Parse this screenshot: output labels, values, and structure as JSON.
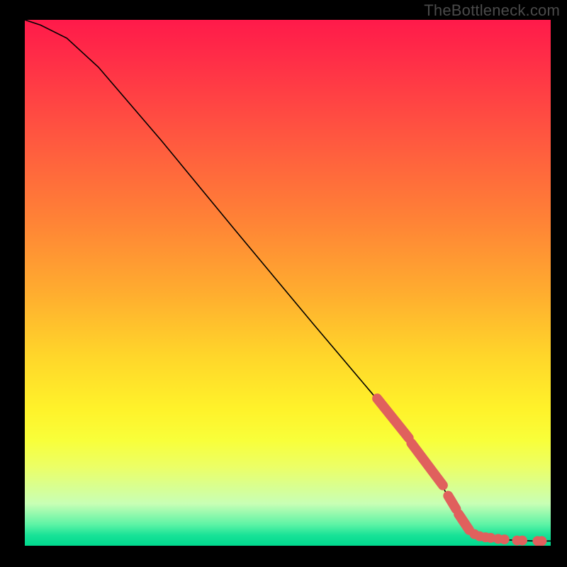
{
  "attribution": "TheBottleneck.com",
  "chart_data": {
    "type": "line",
    "title": "",
    "xlabel": "",
    "ylabel": "",
    "xlim": [
      0,
      100
    ],
    "ylim": [
      0,
      100
    ],
    "curve": [
      {
        "x": 0,
        "y": 100
      },
      {
        "x": 3,
        "y": 99
      },
      {
        "x": 8,
        "y": 96.5
      },
      {
        "x": 14,
        "y": 91
      },
      {
        "x": 26,
        "y": 77
      },
      {
        "x": 40,
        "y": 60
      },
      {
        "x": 55,
        "y": 42
      },
      {
        "x": 66,
        "y": 29
      },
      {
        "x": 74,
        "y": 19
      },
      {
        "x": 79,
        "y": 12
      },
      {
        "x": 83,
        "y": 5
      },
      {
        "x": 85,
        "y": 2.5
      },
      {
        "x": 87,
        "y": 1.5
      },
      {
        "x": 90,
        "y": 1.2
      },
      {
        "x": 94,
        "y": 1.0
      },
      {
        "x": 97,
        "y": 0.9
      },
      {
        "x": 100,
        "y": 0.9
      }
    ],
    "highlight_segments": [
      {
        "x1": 67,
        "y1": 28,
        "x2": 73,
        "y2": 20.5
      },
      {
        "x1": 73.5,
        "y1": 19.5,
        "x2": 79.5,
        "y2": 11.5
      },
      {
        "x1": 80.5,
        "y1": 9.5,
        "x2": 82,
        "y2": 7
      },
      {
        "x1": 82.5,
        "y1": 6,
        "x2": 84.5,
        "y2": 3
      }
    ],
    "highlight_points": [
      {
        "x": 85.5,
        "y": 2.2
      },
      {
        "x": 86.5,
        "y": 1.8
      },
      {
        "x": 87.6,
        "y": 1.6
      },
      {
        "x": 88.6,
        "y": 1.5
      },
      {
        "x": 90.0,
        "y": 1.3
      },
      {
        "x": 91.2,
        "y": 1.2
      },
      {
        "x": 93.6,
        "y": 1.0
      },
      {
        "x": 94.6,
        "y": 1.0
      },
      {
        "x": 97.5,
        "y": 0.9
      },
      {
        "x": 98.3,
        "y": 0.9
      }
    ],
    "highlight_color": "#e0605d",
    "curve_color": "#000000"
  }
}
